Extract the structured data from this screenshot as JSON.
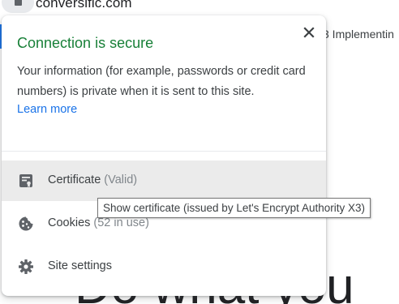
{
  "browser": {
    "url": "conversific.com"
  },
  "background_page": {
    "tab_link_text": "3 Implementin",
    "heading_text": "Do what you"
  },
  "popup": {
    "title": "Connection is secure",
    "description": "Your information (for example, passwords or credit card numbers) is private when it is sent to this site.",
    "learn_more": "Learn more",
    "close_icon": "close-icon",
    "items": [
      {
        "icon": "certificate-icon",
        "label": "Certificate",
        "status": "(Valid)"
      },
      {
        "icon": "cookie-icon",
        "label": "Cookies",
        "status": "(52 in use)"
      },
      {
        "icon": "gear-icon",
        "label": "Site settings",
        "status": ""
      }
    ]
  },
  "tooltip": {
    "text": "Show certificate (issued by Let's Encrypt Authority X3)"
  },
  "colors": {
    "secure_green": "#188038",
    "link_blue": "#1a73e8",
    "text_primary": "#3c4043",
    "text_secondary": "#80868b",
    "hover_background": "#ebebeb"
  }
}
